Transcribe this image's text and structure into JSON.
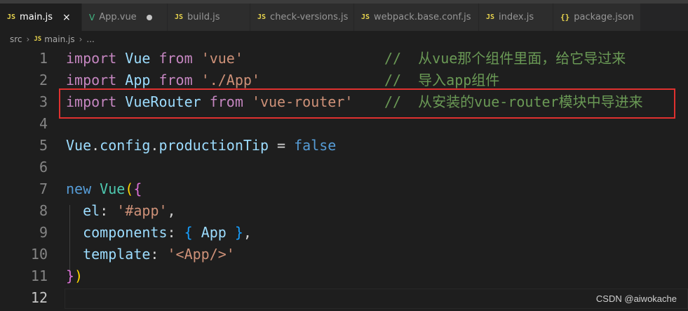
{
  "tabs": [
    {
      "label": "main.js",
      "icon": "js-icon",
      "active": true,
      "state": "close"
    },
    {
      "label": "App.vue",
      "icon": "vue-icon",
      "active": false,
      "state": "modified"
    },
    {
      "label": "build.js",
      "icon": "js-icon",
      "active": false
    },
    {
      "label": "check-versions.js",
      "icon": "js-icon",
      "active": false
    },
    {
      "label": "webpack.base.conf.js",
      "icon": "js-icon",
      "active": false
    },
    {
      "label": "index.js",
      "icon": "js-icon",
      "active": false
    },
    {
      "label": "package.json",
      "icon": "json-icon",
      "active": false
    }
  ],
  "icons": {
    "js": "JS",
    "vue": "V",
    "json": "{}",
    "close": "×",
    "chevron": "›"
  },
  "breadcrumb": {
    "folder": "src",
    "file": "main.js",
    "more": "..."
  },
  "lines": [
    {
      "n": "1",
      "code": [
        [
          "kw",
          "import"
        ],
        [
          "pl",
          " "
        ],
        [
          "id",
          "Vue"
        ],
        [
          "pl",
          " "
        ],
        [
          "kw",
          "from"
        ],
        [
          "pl",
          " "
        ],
        [
          "str",
          "'vue'"
        ]
      ],
      "comment": "//  从vue那个组件里面，给它导过来"
    },
    {
      "n": "2",
      "code": [
        [
          "kw",
          "import"
        ],
        [
          "pl",
          " "
        ],
        [
          "id",
          "App"
        ],
        [
          "pl",
          " "
        ],
        [
          "kw",
          "from"
        ],
        [
          "pl",
          " "
        ],
        [
          "str",
          "'./App'"
        ]
      ],
      "comment": "//  导入app组件"
    },
    {
      "n": "3",
      "code": [
        [
          "kw",
          "import"
        ],
        [
          "pl",
          " "
        ],
        [
          "id",
          "VueRouter"
        ],
        [
          "pl",
          " "
        ],
        [
          "kw",
          "from"
        ],
        [
          "pl",
          " "
        ],
        [
          "str",
          "'vue-router'"
        ]
      ],
      "comment": "//  从安装的vue-router模块中导进来"
    },
    {
      "n": "4",
      "code": [],
      "comment": ""
    },
    {
      "n": "5",
      "code": [
        [
          "id",
          "Vue"
        ],
        [
          "pl",
          "."
        ],
        [
          "id",
          "config"
        ],
        [
          "pl",
          "."
        ],
        [
          "id",
          "productionTip"
        ],
        [
          "pl",
          " = "
        ],
        [
          "bool",
          "false"
        ]
      ],
      "comment": ""
    },
    {
      "n": "6",
      "code": [],
      "comment": ""
    },
    {
      "n": "7",
      "code": [
        [
          "bool",
          "new"
        ],
        [
          "pl",
          " "
        ],
        [
          "cls",
          "Vue"
        ],
        [
          "br1",
          "("
        ],
        [
          "br2",
          "{"
        ]
      ],
      "comment": ""
    },
    {
      "n": "8",
      "code": [
        [
          "pl",
          "  "
        ],
        [
          "id",
          "el"
        ],
        [
          "pl",
          ": "
        ],
        [
          "str",
          "'#app'"
        ],
        [
          "pl",
          ","
        ]
      ],
      "comment": ""
    },
    {
      "n": "9",
      "code": [
        [
          "pl",
          "  "
        ],
        [
          "id",
          "components"
        ],
        [
          "pl",
          ": "
        ],
        [
          "br3",
          "{"
        ],
        [
          "pl",
          " "
        ],
        [
          "id",
          "App"
        ],
        [
          "pl",
          " "
        ],
        [
          "br3",
          "}"
        ],
        [
          "pl",
          ","
        ]
      ],
      "comment": ""
    },
    {
      "n": "10",
      "code": [
        [
          "pl",
          "  "
        ],
        [
          "id",
          "template"
        ],
        [
          "pl",
          ": "
        ],
        [
          "str",
          "'<App/>'"
        ]
      ],
      "comment": ""
    },
    {
      "n": "11",
      "code": [
        [
          "br2",
          "}"
        ],
        [
          "br1",
          ")"
        ]
      ],
      "comment": ""
    },
    {
      "n": "12",
      "code": [],
      "comment": ""
    }
  ],
  "highlight_line": "3",
  "current_line": "12",
  "watermark": "CSDN @aiwokache"
}
